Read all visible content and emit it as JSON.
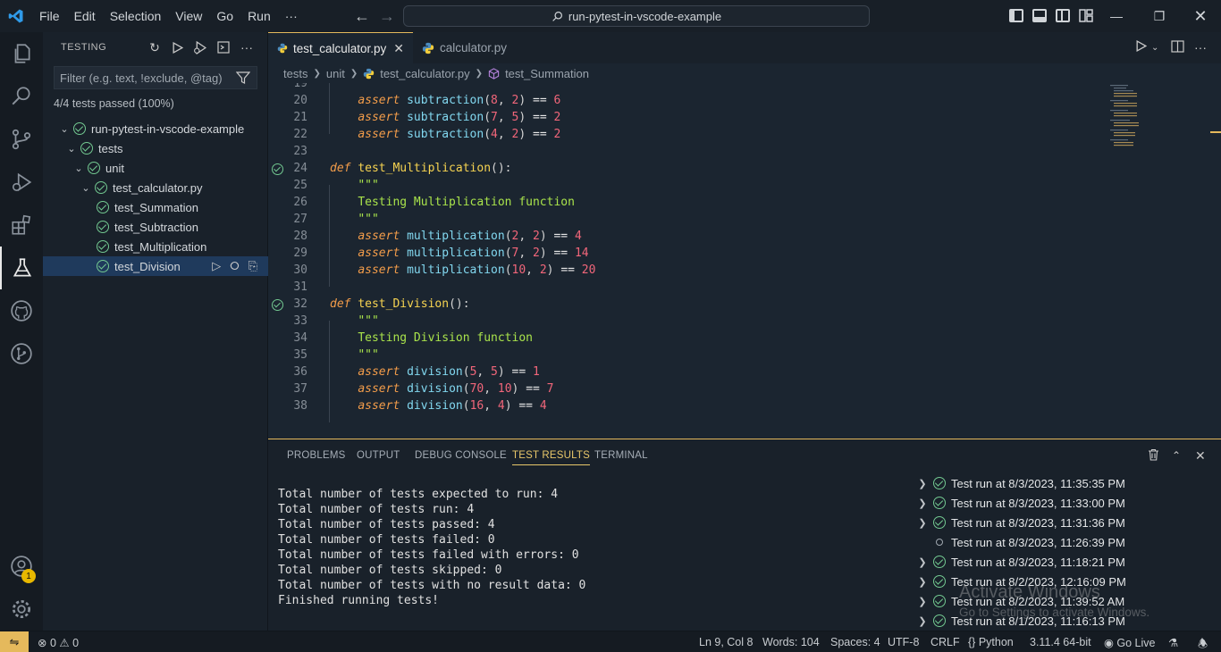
{
  "titlebar": {
    "menus": [
      "File",
      "Edit",
      "Selection",
      "View",
      "Go",
      "Run",
      "···"
    ],
    "search_text": "run-pytest-in-vscode-example"
  },
  "sidebar": {
    "title": "TESTING",
    "filter_placeholder": "Filter (e.g. text, !exclude, @tag)",
    "passed_text": "4/4 tests passed (100%)",
    "tree": [
      {
        "label": "run-pytest-in-vscode-example",
        "level": 0,
        "expanded": true
      },
      {
        "label": "tests",
        "level": 1,
        "expanded": true
      },
      {
        "label": "unit",
        "level": 2,
        "expanded": true
      },
      {
        "label": "test_calculator.py",
        "level": 3,
        "expanded": true
      },
      {
        "label": "test_Summation",
        "level": 4
      },
      {
        "label": "test_Subtraction",
        "level": 4
      },
      {
        "label": "test_Multiplication",
        "level": 4
      },
      {
        "label": "test_Division",
        "level": 4,
        "selected": true
      }
    ]
  },
  "editor": {
    "tabs": [
      {
        "label": "test_calculator.py",
        "active": true
      },
      {
        "label": "calculator.py",
        "active": false
      }
    ],
    "breadcrumb": [
      "tests",
      "unit",
      "test_calculator.py",
      "test_Summation"
    ],
    "lines": [
      {
        "n": "19",
        "tokens": []
      },
      {
        "n": "20",
        "tokens": [
          [
            "    ",
            ""
          ],
          [
            "assert",
            "kw"
          ],
          [
            " ",
            ""
          ],
          [
            "subtraction",
            "fn"
          ],
          [
            "(",
            ""
          ],
          [
            "8",
            "num"
          ],
          [
            ", ",
            ""
          ],
          [
            "2",
            "num"
          ],
          [
            ") ",
            ""
          ],
          [
            "==",
            "op"
          ],
          [
            " ",
            ""
          ],
          [
            "6",
            "num"
          ]
        ]
      },
      {
        "n": "21",
        "tokens": [
          [
            "    ",
            ""
          ],
          [
            "assert",
            "kw"
          ],
          [
            " ",
            ""
          ],
          [
            "subtraction",
            "fn"
          ],
          [
            "(",
            ""
          ],
          [
            "7",
            "num"
          ],
          [
            ", ",
            ""
          ],
          [
            "5",
            "num"
          ],
          [
            ") ",
            ""
          ],
          [
            "==",
            "op"
          ],
          [
            " ",
            ""
          ],
          [
            "2",
            "num"
          ]
        ]
      },
      {
        "n": "22",
        "tokens": [
          [
            "    ",
            ""
          ],
          [
            "assert",
            "kw"
          ],
          [
            " ",
            ""
          ],
          [
            "subtraction",
            "fn"
          ],
          [
            "(",
            ""
          ],
          [
            "4",
            "num"
          ],
          [
            ", ",
            ""
          ],
          [
            "2",
            "num"
          ],
          [
            ") ",
            ""
          ],
          [
            "==",
            "op"
          ],
          [
            " ",
            ""
          ],
          [
            "2",
            "num"
          ]
        ]
      },
      {
        "n": "23",
        "tokens": []
      },
      {
        "n": "24",
        "check": true,
        "tokens": [
          [
            "def",
            "kw"
          ],
          [
            " ",
            ""
          ],
          [
            "test_Multiplication",
            "deffn"
          ],
          [
            "():",
            ""
          ]
        ]
      },
      {
        "n": "25",
        "tokens": [
          [
            "    ",
            ""
          ],
          [
            "\"\"\"",
            "str"
          ]
        ]
      },
      {
        "n": "26",
        "tokens": [
          [
            "    ",
            ""
          ],
          [
            "Testing Multiplication function",
            "str"
          ]
        ]
      },
      {
        "n": "27",
        "tokens": [
          [
            "    ",
            ""
          ],
          [
            "\"\"\"",
            "str"
          ]
        ]
      },
      {
        "n": "28",
        "tokens": [
          [
            "    ",
            ""
          ],
          [
            "assert",
            "kw"
          ],
          [
            " ",
            ""
          ],
          [
            "multiplication",
            "fn"
          ],
          [
            "(",
            ""
          ],
          [
            "2",
            "num"
          ],
          [
            ", ",
            ""
          ],
          [
            "2",
            "num"
          ],
          [
            ") ",
            ""
          ],
          [
            "==",
            "op"
          ],
          [
            " ",
            ""
          ],
          [
            "4",
            "num"
          ]
        ]
      },
      {
        "n": "29",
        "tokens": [
          [
            "    ",
            ""
          ],
          [
            "assert",
            "kw"
          ],
          [
            " ",
            ""
          ],
          [
            "multiplication",
            "fn"
          ],
          [
            "(",
            ""
          ],
          [
            "7",
            "num"
          ],
          [
            ", ",
            ""
          ],
          [
            "2",
            "num"
          ],
          [
            ") ",
            ""
          ],
          [
            "==",
            "op"
          ],
          [
            " ",
            ""
          ],
          [
            "14",
            "num"
          ]
        ]
      },
      {
        "n": "30",
        "tokens": [
          [
            "    ",
            ""
          ],
          [
            "assert",
            "kw"
          ],
          [
            " ",
            ""
          ],
          [
            "multiplication",
            "fn"
          ],
          [
            "(",
            ""
          ],
          [
            "10",
            "num"
          ],
          [
            ", ",
            ""
          ],
          [
            "2",
            "num"
          ],
          [
            ") ",
            ""
          ],
          [
            "==",
            "op"
          ],
          [
            " ",
            ""
          ],
          [
            "20",
            "num"
          ]
        ]
      },
      {
        "n": "31",
        "tokens": []
      },
      {
        "n": "32",
        "check": true,
        "tokens": [
          [
            "def",
            "kw"
          ],
          [
            " ",
            ""
          ],
          [
            "test_Division",
            "deffn"
          ],
          [
            "():",
            ""
          ]
        ]
      },
      {
        "n": "33",
        "tokens": [
          [
            "    ",
            ""
          ],
          [
            "\"\"\"",
            "str"
          ]
        ]
      },
      {
        "n": "34",
        "tokens": [
          [
            "    ",
            ""
          ],
          [
            "Testing Division function",
            "str"
          ]
        ]
      },
      {
        "n": "35",
        "tokens": [
          [
            "    ",
            ""
          ],
          [
            "\"\"\"",
            "str"
          ]
        ]
      },
      {
        "n": "36",
        "tokens": [
          [
            "    ",
            ""
          ],
          [
            "assert",
            "kw"
          ],
          [
            " ",
            ""
          ],
          [
            "division",
            "fn"
          ],
          [
            "(",
            ""
          ],
          [
            "5",
            "num"
          ],
          [
            ", ",
            ""
          ],
          [
            "5",
            "num"
          ],
          [
            ") ",
            ""
          ],
          [
            "==",
            "op"
          ],
          [
            " ",
            ""
          ],
          [
            "1",
            "num"
          ]
        ]
      },
      {
        "n": "37",
        "tokens": [
          [
            "    ",
            ""
          ],
          [
            "assert",
            "kw"
          ],
          [
            " ",
            ""
          ],
          [
            "division",
            "fn"
          ],
          [
            "(",
            ""
          ],
          [
            "70",
            "num"
          ],
          [
            ", ",
            ""
          ],
          [
            "10",
            "num"
          ],
          [
            ") ",
            ""
          ],
          [
            "==",
            "op"
          ],
          [
            " ",
            ""
          ],
          [
            "7",
            "num"
          ]
        ]
      },
      {
        "n": "38",
        "tokens": [
          [
            "    ",
            ""
          ],
          [
            "assert",
            "kw"
          ],
          [
            " ",
            ""
          ],
          [
            "division",
            "fn"
          ],
          [
            "(",
            ""
          ],
          [
            "16",
            "num"
          ],
          [
            ", ",
            ""
          ],
          [
            "4",
            "num"
          ],
          [
            ") ",
            ""
          ],
          [
            "==",
            "op"
          ],
          [
            " ",
            ""
          ],
          [
            "4",
            "num"
          ]
        ]
      }
    ]
  },
  "panel": {
    "tabs": [
      "PROBLEMS",
      "OUTPUT",
      "DEBUG CONSOLE",
      "TEST RESULTS",
      "TERMINAL"
    ],
    "active_tab": "TEST RESULTS",
    "output_lines": [
      "Total number of tests expected to run: 4",
      "Total number of tests run: 4",
      "Total number of tests passed: 4",
      "Total number of tests failed: 0",
      "Total number of tests failed with errors: 0",
      "Total number of tests skipped: 0",
      "Total number of tests with no result data: 0",
      "Finished running tests!"
    ],
    "runs": [
      {
        "label": "Test run at 8/3/2023, 11:35:35 PM",
        "status": "passed",
        "expandable": true
      },
      {
        "label": "Test run at 8/3/2023, 11:33:00 PM",
        "status": "passed",
        "expandable": true
      },
      {
        "label": "Test run at 8/3/2023, 11:31:36 PM",
        "status": "passed",
        "expandable": true
      },
      {
        "label": "Test run at 8/3/2023, 11:26:39 PM",
        "status": "pending",
        "expandable": false
      },
      {
        "label": "Test run at 8/3/2023, 11:18:21 PM",
        "status": "passed",
        "expandable": true
      },
      {
        "label": "Test run at 8/2/2023, 12:16:09 PM",
        "status": "passed",
        "expandable": true
      },
      {
        "label": "Test run at 8/2/2023, 11:39:52 AM",
        "status": "passed",
        "expandable": true
      },
      {
        "label": "Test run at 8/1/2023, 11:16:13 PM",
        "status": "passed",
        "expandable": true
      }
    ],
    "watermark_title": "Activate Windows",
    "watermark_sub": "Go to Settings to activate Windows."
  },
  "activity": {
    "accounts_badge": "1"
  },
  "statusbar": {
    "problems": "0",
    "warnings": "0",
    "cursor": "Ln 9, Col 8",
    "words": "Words: 104",
    "spaces": "Spaces: 4",
    "encoding": "UTF-8",
    "eol": "CRLF",
    "language": "Python",
    "interpreter": "3.11.4 64-bit",
    "golive": "Go Live"
  },
  "colors": {
    "accent": "#e5b95c",
    "pass": "#73c991",
    "selection": "#1f3a5c"
  }
}
